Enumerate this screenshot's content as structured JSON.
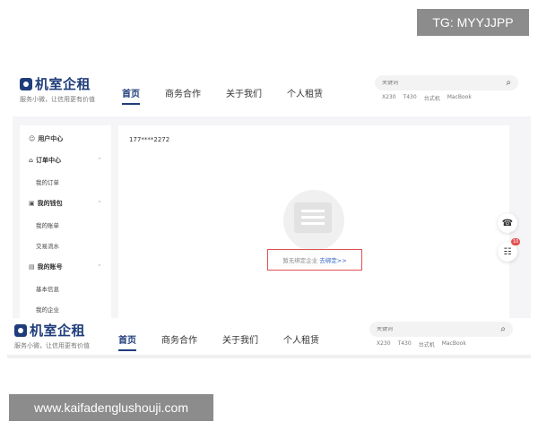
{
  "watermark": {
    "top": "TG: MYYJJPP",
    "bottom": "www.kaifadenglushouji.com"
  },
  "brand": {
    "name": "机室企租",
    "tagline": "服务小微，让信用更有价值"
  },
  "nav": {
    "items": [
      "首页",
      "商务合作",
      "关于我们",
      "个人租赁"
    ],
    "active_index": 0
  },
  "search": {
    "placeholder": "关键词",
    "hot": [
      "X230",
      "T430",
      "台式机",
      "MacBook"
    ]
  },
  "sidebar": {
    "user_center": "用户中心",
    "orders": {
      "title": "订单中心",
      "items": [
        "我的订单"
      ]
    },
    "wallet": {
      "title": "我的钱包",
      "items": [
        "我的账单",
        "交易流水"
      ]
    },
    "account": {
      "title": "我的账号",
      "items": [
        "基本信息",
        "我的企业"
      ]
    }
  },
  "panel": {
    "phone": "177****2272",
    "empty_text": "暂无绑定企业",
    "empty_link": "去绑定>>"
  },
  "float": {
    "badge_count": "10"
  },
  "colors": {
    "brand": "#1f3d7a",
    "highlight_border": "#e05050",
    "link": "#2f62c7"
  }
}
